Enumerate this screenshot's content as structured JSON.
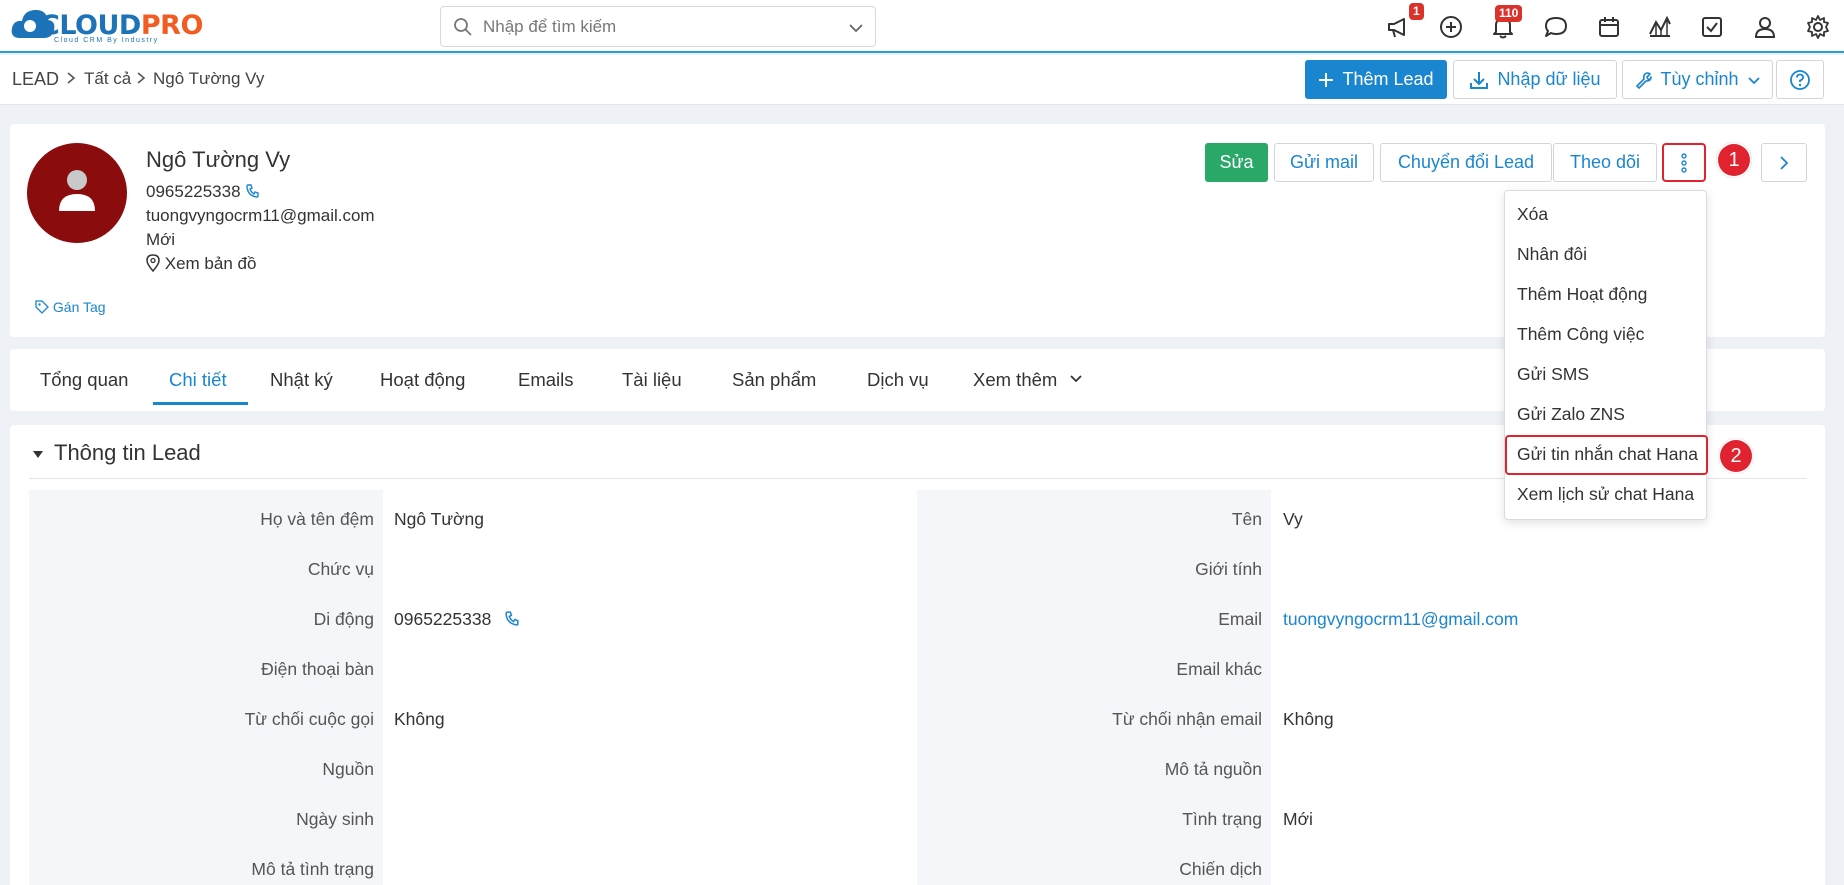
{
  "app": {
    "logo_main": "CLOUD",
    "logo_accent": "PRO",
    "logo_tagline": "Cloud CRM By Industry",
    "search_placeholder": "Nhập để tìm kiếm",
    "announce_badge": "1",
    "notif_badge": "110"
  },
  "breadcrumb": {
    "module": "LEAD",
    "all": "Tất cả",
    "current": "Ngô Tường Vy"
  },
  "toolbar": {
    "add_lead": "Thêm Lead",
    "import": "Nhập dữ liệu",
    "customize": "Tùy chỉnh"
  },
  "record": {
    "name": "Ngô Tường Vy",
    "phone": "0965225338",
    "email": "tuongvyngocrm11@gmail.com",
    "status": "Mới",
    "map_link": "Xem bản đồ",
    "tag_link": "Gán Tag"
  },
  "actions": {
    "edit": "Sửa",
    "send_mail": "Gửi mail",
    "convert": "Chuyển đổi Lead",
    "follow": "Theo dõi"
  },
  "markers": {
    "one": "1",
    "two": "2"
  },
  "menu": {
    "items": [
      "Xóa",
      "Nhân đôi",
      "Thêm Hoạt động",
      "Thêm Công việc",
      "Gửi SMS",
      "Gửi Zalo ZNS",
      "Gửi tin nhắn chat Hana",
      "Xem lịch sử chat Hana"
    ]
  },
  "tabs": [
    "Tổng quan",
    "Chi tiết",
    "Nhật ký",
    "Hoạt động",
    "Emails",
    "Tài liệu",
    "Sản phẩm",
    "Dịch vụ",
    "Xem thêm"
  ],
  "section": {
    "title": "Thông tin Lead",
    "left": [
      {
        "label": "Họ và tên đệm",
        "value": "Ngô Tường"
      },
      {
        "label": "Chức vụ",
        "value": ""
      },
      {
        "label": "Di động",
        "value": "0965225338"
      },
      {
        "label": "Điện thoại bàn",
        "value": ""
      },
      {
        "label": "Từ chối cuộc gọi",
        "value": "Không"
      },
      {
        "label": "Nguồn",
        "value": ""
      },
      {
        "label": "Ngày sinh",
        "value": ""
      },
      {
        "label": "Mô tả tình trạng",
        "value": ""
      }
    ],
    "right": [
      {
        "label": "Tên",
        "value": "Vy"
      },
      {
        "label": "Giới tính",
        "value": ""
      },
      {
        "label": "Email",
        "value": "tuongvyngocrm11@gmail.com"
      },
      {
        "label": "Email khác",
        "value": ""
      },
      {
        "label": "Từ chối nhận email",
        "value": "Không"
      },
      {
        "label": "Mô tả nguồn",
        "value": ""
      },
      {
        "label": "Tình trạng",
        "value": "Mới"
      },
      {
        "label": "Chiến dịch",
        "value": ""
      }
    ]
  },
  "colors": {
    "primary": "#1a86d0",
    "success": "#2aa867",
    "highlight": "#e0232f",
    "avatar": "#8b0c0c"
  }
}
